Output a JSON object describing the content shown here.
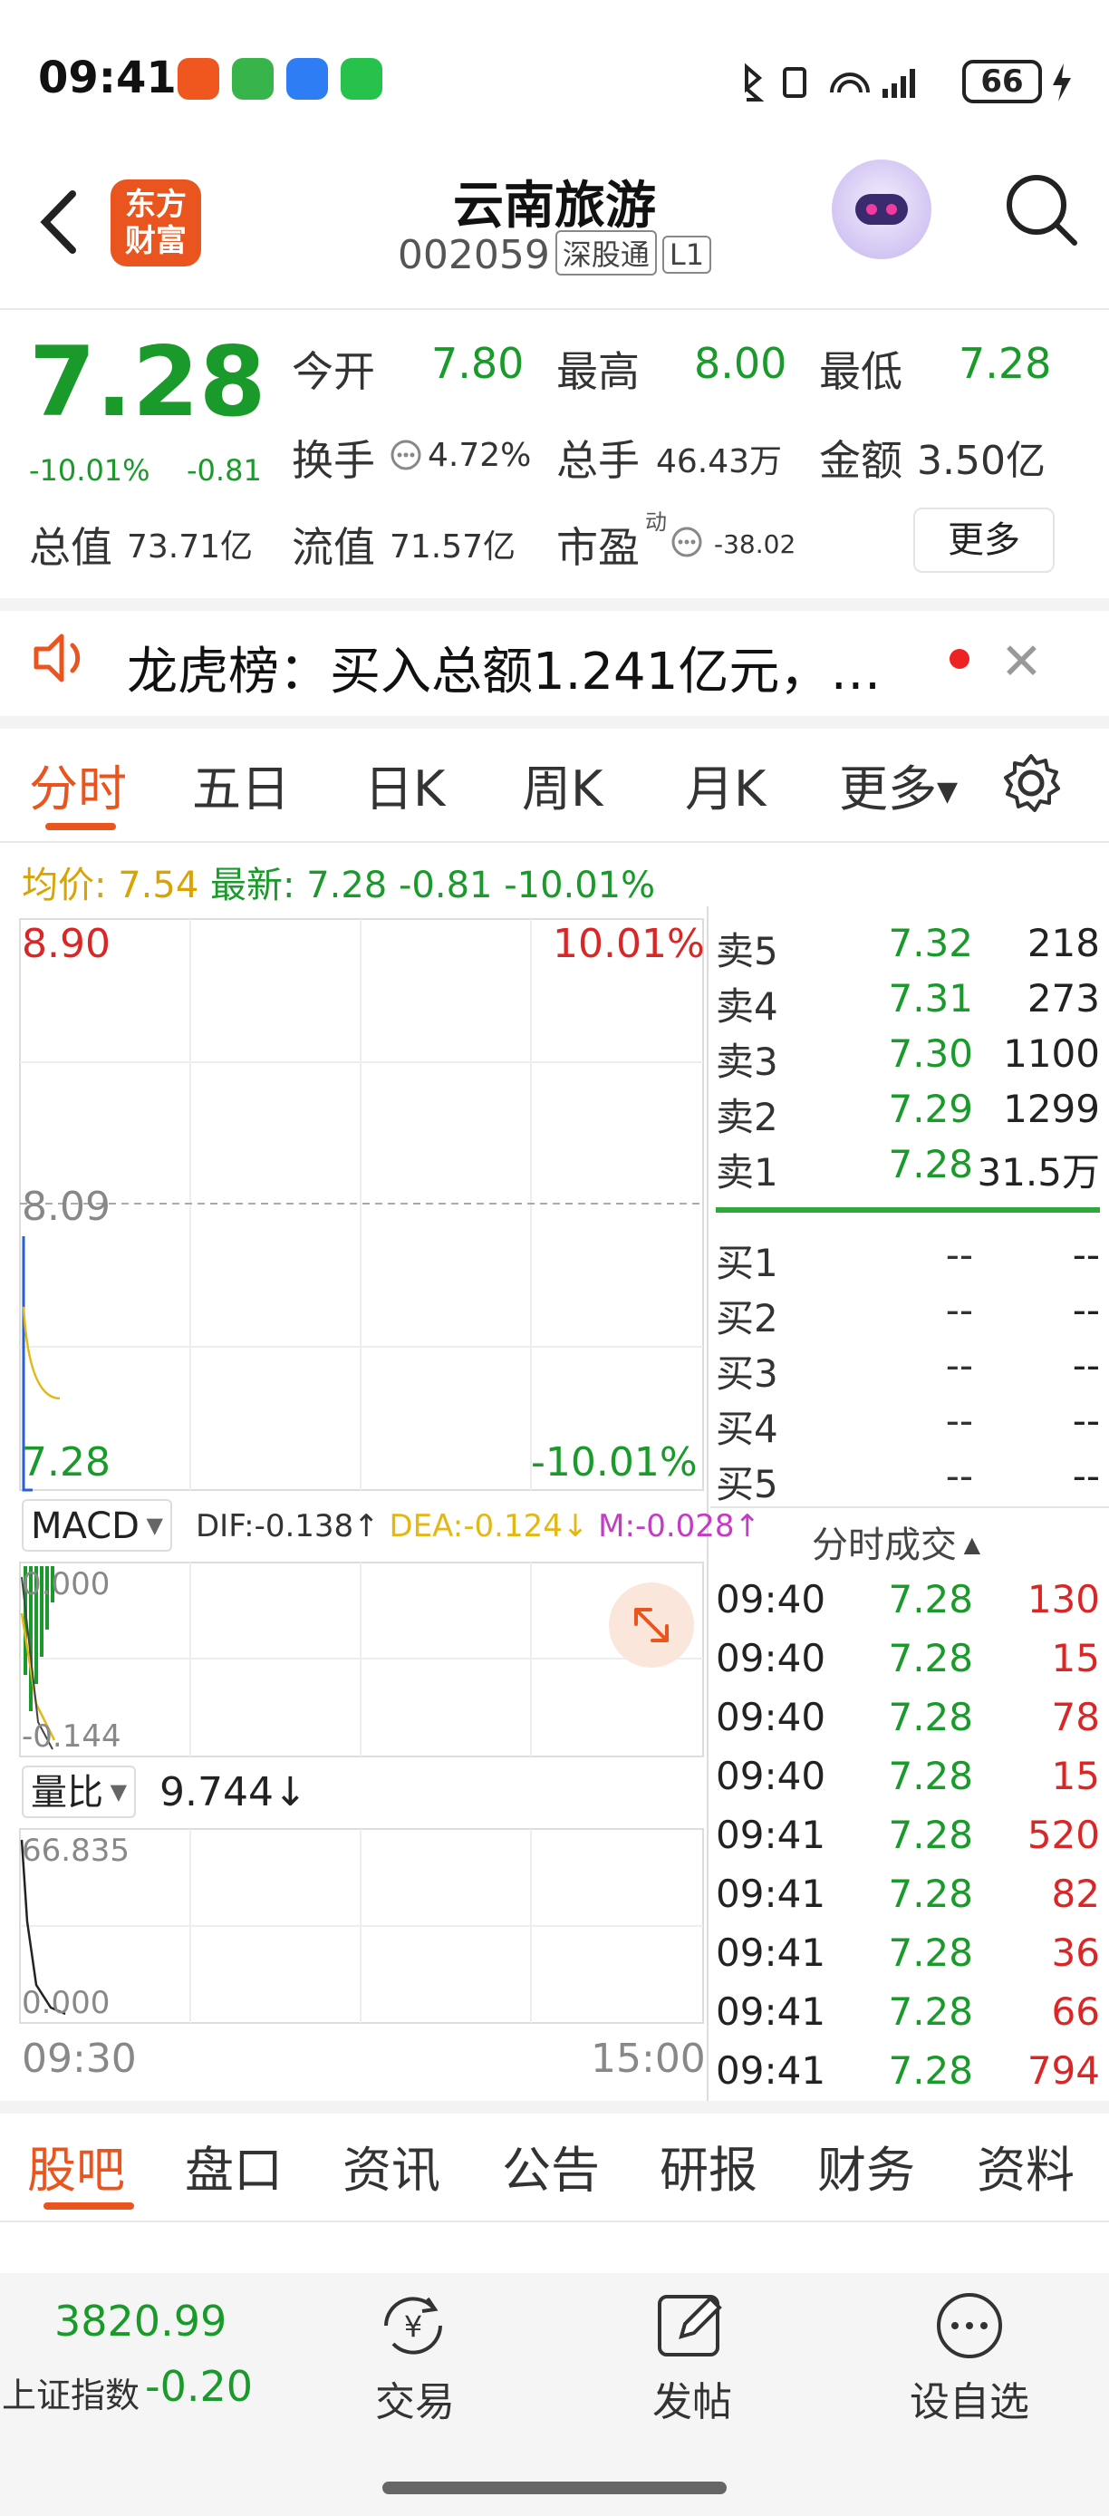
{
  "status_bar": {
    "time": "09:41",
    "battery": "66"
  },
  "header": {
    "logo_text_1": "东方",
    "logo_text_2": "财富",
    "stock_name": "云南旅游",
    "stock_code": "002059",
    "tag_1": "深股通",
    "tag_2": "L1",
    "icons": [
      "back-arrow-icon",
      "robot-avatar-icon",
      "search-icon"
    ]
  },
  "quote": {
    "price": "7.28",
    "change_pct": "-10.01%",
    "change": "-0.81",
    "open_label": "今开",
    "open_value": "7.80",
    "high_label": "最高",
    "high_value": "8.00",
    "low_label": "最低",
    "low_value": "7.28",
    "turnover_label": "换手",
    "turnover_value": "4.72%",
    "volume_label": "总手",
    "volume_value": "46.43万",
    "amount_label": "金额",
    "amount_value": "3.50亿",
    "total_cap_label": "总值",
    "total_cap_value": "73.71亿",
    "float_cap_label": "流值",
    "float_cap_value": "71.57亿",
    "pe_label": "市盈",
    "pe_sup": "动",
    "pe_value": "-38.02",
    "more_label": "更多"
  },
  "notice": {
    "text": "龙虎榜：买入总额1.241亿元，…"
  },
  "tabs": {
    "items": [
      "分时",
      "五日",
      "日K",
      "周K",
      "月K",
      "更多"
    ],
    "active": "分时"
  },
  "avg_line": {
    "avg_label": "均价:",
    "avg_value": "7.54",
    "latest_label": "最新:",
    "latest_value": "7.28",
    "latest_change": "-0.81",
    "latest_pct": "-10.01%"
  },
  "chart_data": {
    "type": "line",
    "price_axis": {
      "top": "8.90",
      "mid": "8.09",
      "bottom": "7.28",
      "top_pct": "10.01%",
      "bottom_pct": "-10.01%"
    },
    "time_axis": {
      "start": "09:30",
      "end": "15:00"
    },
    "series": [
      {
        "name": "price",
        "color": "#2a5fd0",
        "values": [
          8.0,
          7.28
        ]
      },
      {
        "name": "avg",
        "color": "#e3b814",
        "values": [
          7.8,
          7.54
        ]
      }
    ],
    "macd": {
      "label": "MACD",
      "dif": "DIF:-0.138↑",
      "dea": "DEA:-0.124↓",
      "m": "M:-0.028↑",
      "top": "0.000",
      "bottom": "-0.144"
    },
    "volume_ratio": {
      "label": "量比",
      "value": "9.744↓",
      "top": "66.835",
      "bottom": "0.000"
    }
  },
  "order_book": {
    "asks": [
      {
        "label": "卖5",
        "price": "7.32",
        "vol": "218"
      },
      {
        "label": "卖4",
        "price": "7.31",
        "vol": "273"
      },
      {
        "label": "卖3",
        "price": "7.30",
        "vol": "1100"
      },
      {
        "label": "卖2",
        "price": "7.29",
        "vol": "1299"
      },
      {
        "label": "卖1",
        "price": "7.28",
        "vol": "31.5万"
      }
    ],
    "bids": [
      {
        "label": "买1",
        "price": "--",
        "vol": "--"
      },
      {
        "label": "买2",
        "price": "--",
        "vol": "--"
      },
      {
        "label": "买3",
        "price": "--",
        "vol": "--"
      },
      {
        "label": "买4",
        "price": "--",
        "vol": "--"
      },
      {
        "label": "买5",
        "price": "--",
        "vol": "--"
      }
    ]
  },
  "trades": {
    "title": "分时成交",
    "rows": [
      {
        "time": "09:40",
        "price": "7.28",
        "vol": "130"
      },
      {
        "time": "09:40",
        "price": "7.28",
        "vol": "15"
      },
      {
        "time": "09:40",
        "price": "7.28",
        "vol": "78"
      },
      {
        "time": "09:40",
        "price": "7.28",
        "vol": "15"
      },
      {
        "time": "09:41",
        "price": "7.28",
        "vol": "520"
      },
      {
        "time": "09:41",
        "price": "7.28",
        "vol": "82"
      },
      {
        "time": "09:41",
        "price": "7.28",
        "vol": "36"
      },
      {
        "time": "09:41",
        "price": "7.28",
        "vol": "66"
      },
      {
        "time": "09:41",
        "price": "7.28",
        "vol": "794"
      }
    ]
  },
  "sub_tabs": {
    "items": [
      "股吧",
      "盘口",
      "资讯",
      "公告",
      "研报",
      "财务",
      "资料"
    ],
    "active": "股吧"
  },
  "bottom_bar": {
    "index_value": "3820.99",
    "index_name": "上证指数",
    "index_change": "-0.20",
    "trade_label": "交易",
    "post_label": "发帖",
    "watch_label": "设自选"
  }
}
